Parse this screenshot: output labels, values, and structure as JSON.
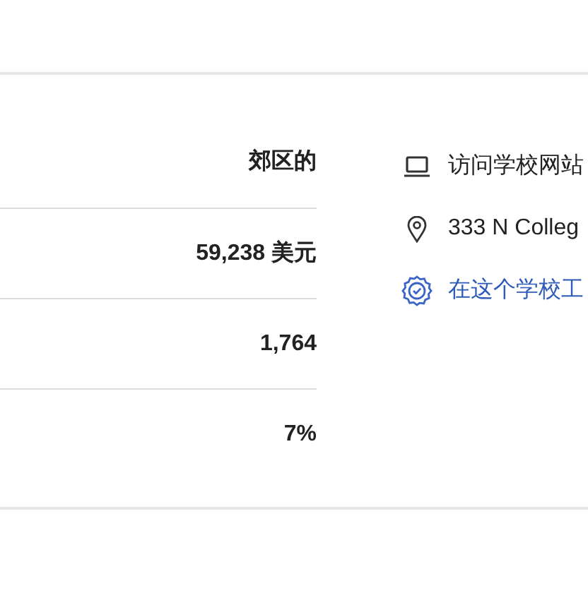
{
  "stats": [
    {
      "value": "郊区的"
    },
    {
      "value": "59,238 美元"
    },
    {
      "value": "1,764"
    },
    {
      "value": "7%"
    }
  ],
  "links": [
    {
      "kind": "website",
      "text": "访问学校网站"
    },
    {
      "kind": "address",
      "text": "333 N Colleg"
    },
    {
      "kind": "work",
      "text": "在这个学校工"
    }
  ]
}
